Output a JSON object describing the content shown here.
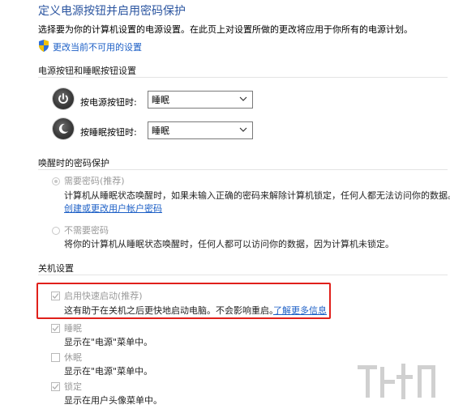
{
  "title": "定义电源按钮并启用密码保护",
  "subtitle": "选择要为你的计算机设置的电源设置。在此页上对设置所做的更改将应用于你所有的电源计划。",
  "change_settings_link": "更改当前不可用的设置",
  "power_section": {
    "header": "电源按钮和睡眠按钮设置",
    "rows": [
      {
        "label": "按电源按钮时:",
        "value": "睡眠",
        "icon": "power-icon"
      },
      {
        "label": "按睡眠按钮时:",
        "value": "睡眠",
        "icon": "sleep-icon"
      }
    ]
  },
  "wake_section": {
    "header": "唤醒时的密码保护",
    "options": [
      {
        "label": "需要密码(推荐)",
        "selected": true,
        "desc": "计算机从睡眠状态唤醒时，如果未输入正确的密码来解除计算机锁定，任何人都无法访问你的数据。",
        "link": "创建或更改用户帐户密码"
      },
      {
        "label": "不需要密码",
        "selected": false,
        "desc": "将你的计算机从睡眠状态唤醒时，任何人都可以访问你的数据，因为计算机未锁定。"
      }
    ]
  },
  "shutdown_section": {
    "header": "关机设置",
    "items": [
      {
        "label": "启用快速启动(推荐)",
        "checked": true,
        "desc": "这有助于在关机之后更快地启动电脑。不会影响重启。",
        "link": "了解更多信息"
      },
      {
        "label": "睡眠",
        "checked": true,
        "desc": "显示在\"电源\"菜单中。"
      },
      {
        "label": "休眠",
        "checked": false,
        "desc": "显示在\"电源\"菜单中。"
      },
      {
        "label": "锁定",
        "checked": true,
        "desc": "显示在用户头像菜单中。"
      }
    ]
  },
  "colors": {
    "title": "#2b55a0",
    "link": "#1c5fc6",
    "highlight": "#e0201b"
  }
}
